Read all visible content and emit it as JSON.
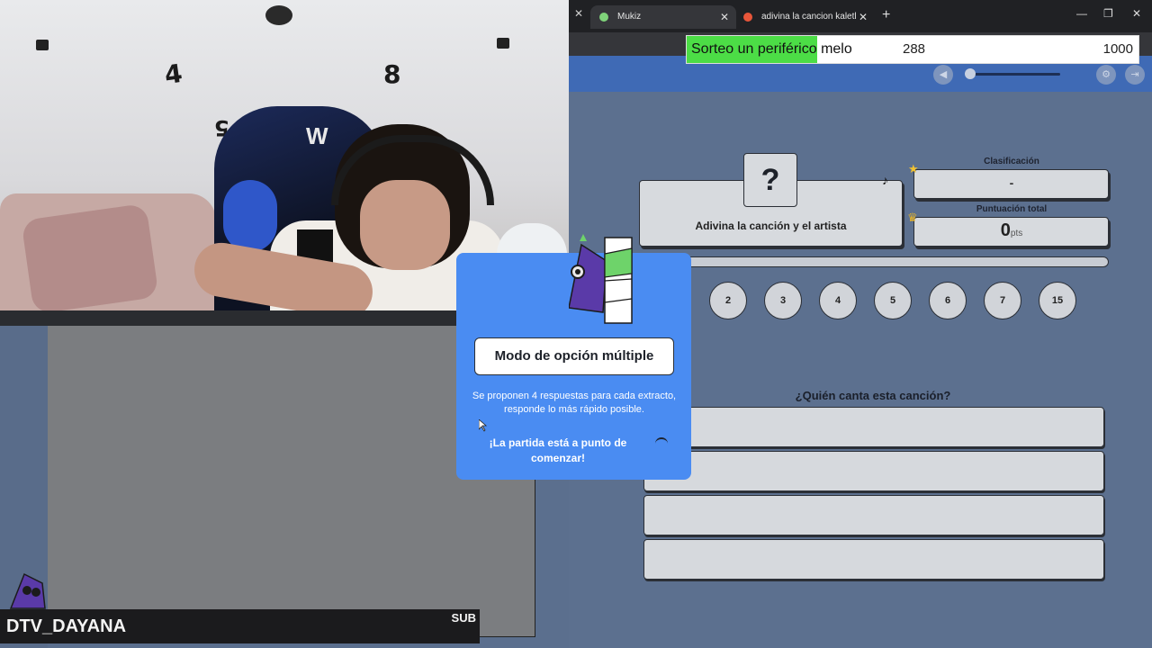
{
  "browser": {
    "tabs": [
      {
        "title": "Mukiz",
        "active": true
      },
      {
        "title": "adivina la cancion kaleth - Brave",
        "active": false
      }
    ],
    "new_tab_symbol": "+",
    "close_symbol": "✕",
    "window_controls": {
      "minimize": "—",
      "maximize": "❐",
      "close": "✕"
    }
  },
  "donation": {
    "label": "Sorteo un periférico melo",
    "current": "288",
    "goal": "1000",
    "progress_fraction": 0.288,
    "fill_color": "#4cdd46"
  },
  "game": {
    "mystery_symbol": "?",
    "song_prompt": "Adivina la canción y el artista",
    "ranking": {
      "title": "Clasificación",
      "value": "-"
    },
    "score": {
      "title": "Puntuación total",
      "value": "0",
      "unit": "pts"
    },
    "rounds": [
      "2",
      "3",
      "4",
      "5",
      "6",
      "7",
      "15"
    ],
    "question": "¿Quién canta esta canción?",
    "answers": [
      "",
      "",
      "",
      ""
    ],
    "header_icons": [
      "mute-icon",
      "settings-icon",
      "exit-icon"
    ]
  },
  "modal": {
    "title": "Modo de opción múltiple",
    "description": "Se proponen 4 respuestas para cada extracto, responde lo más rápido posible.",
    "starting": "¡La partida está a punto de comenzar!"
  },
  "stream": {
    "username": "DTV_DAYANA",
    "badge": "SUB",
    "wall_numbers": [
      "4",
      "8",
      "5"
    ],
    "chair_logo": "W"
  },
  "colors": {
    "modal_bg": "#4a8cf2",
    "game_bg": "#5c708f",
    "header_bg": "#3f6ab5"
  }
}
